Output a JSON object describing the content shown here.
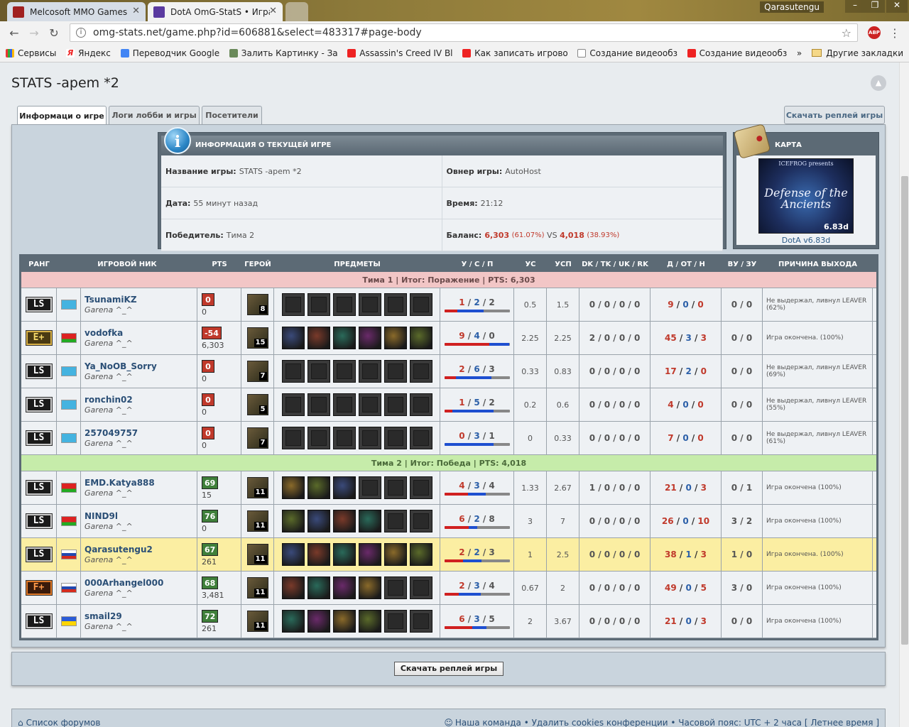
{
  "browser": {
    "tabs": [
      {
        "title": "Melcosoft MMO Games"
      },
      {
        "title": "DotA OmG-StatS • Игра"
      }
    ],
    "user": "Qarasutengu",
    "url": "omg-stats.net/game.php?id=606881&select=483317#page-body",
    "bookmarks": [
      "Сервисы",
      "Яндекс",
      "Переводчик Google",
      "Залить Картинку - За",
      "Assassin's Creed IV Bl",
      "Как записать игрово",
      "Создание видеообз",
      "Создание видеообз"
    ],
    "more": "»",
    "other": "Другие закладки"
  },
  "page": {
    "title": "STATS -apem *2",
    "tabs": [
      "Информаци о игре",
      "Логи лобби и игры",
      "Посетители"
    ],
    "download_top": "Скачать реплей игры",
    "download_bottom": "Скачать реплей игры"
  },
  "info": {
    "header": "ИНФОРМАЦИЯ О ТЕКУЩЕЙ ИГРЕ",
    "name_label": "Название игры:",
    "name": "STATS -apem *2",
    "owner_label": "Овнер игры:",
    "owner": "AutoHost",
    "date_label": "Дата:",
    "date": "55 минут назад",
    "time_label": "Время:",
    "time": "21:12",
    "winner_label": "Победитель:",
    "winner": "Тима 2",
    "balance_label": "Баланс:",
    "balance_a": "6,303",
    "balance_a_pct": "(61.07%)",
    "vs": "VS",
    "balance_b": "4,018",
    "balance_b_pct": "(38.93%)"
  },
  "map": {
    "header": "КАРТА",
    "img_t1": "ICEFROG presents",
    "img_t2": "Defense of the Ancients",
    "img_t3": "6.83d",
    "name": "DotA v6.83d"
  },
  "table": {
    "headers": [
      "РАНГ",
      "ИГРОВОЙ НИК",
      "PTS",
      "ГЕРОЙ",
      "ПРЕДМЕТЫ",
      "У / С / П",
      "УС",
      "УСП",
      "DK / TK / UK / RK",
      "Д / ОТ / Н",
      "ВУ / ЗУ",
      "ПРИЧИНА ВЫХОДА"
    ],
    "team1": "Тима 1 | Итог: Поражение | PTS: 6,303",
    "team2": "Тима 2 | Итог: Победа | PTS: 4,018",
    "players": [
      {
        "rank": "LS",
        "flag": "kz",
        "nick": "TsunamiKZ",
        "sub": "Garena ^_^",
        "pts": "0",
        "pts_total": "0",
        "hero_lvl": "8",
        "items": [
          0,
          0,
          0,
          0,
          0,
          0
        ],
        "k": "1",
        "d": "2",
        "a": "2",
        "us": "0.5",
        "usp": "1.5",
        "dk": "0 / 0 / 0 / 0",
        "dn": "9",
        "ot": "0",
        "n": "0",
        "vu": "0 / 0",
        "reason": "Не выдержал, ливнул LEAVER (62%)",
        "team": 1
      },
      {
        "rank": "E+",
        "flag": "by",
        "nick": "vodofka",
        "sub": "Garena ^_^",
        "pts": "-54",
        "pts_total": "6,303",
        "hero_lvl": "15",
        "items": [
          1,
          1,
          1,
          1,
          1,
          1
        ],
        "k": "9",
        "d": "4",
        "a": "0",
        "us": "2.25",
        "usp": "2.25",
        "dk": "2 / 0 / 0 / 0",
        "dn": "45",
        "ot": "3",
        "n": "3",
        "vu": "0 / 0",
        "reason": "Игра окончена. (100%)",
        "team": 1
      },
      {
        "rank": "LS",
        "flag": "kz",
        "nick": "Ya_NoOB_Sorry",
        "sub": "Garena ^_^",
        "pts": "0",
        "pts_total": "0",
        "hero_lvl": "7",
        "items": [
          0,
          0,
          0,
          0,
          0,
          0
        ],
        "k": "2",
        "d": "6",
        "a": "3",
        "us": "0.33",
        "usp": "0.83",
        "dk": "0 / 0 / 0 / 0",
        "dn": "17",
        "ot": "2",
        "n": "0",
        "vu": "0 / 0",
        "reason": "Не выдержал, ливнул LEAVER (69%)",
        "team": 1
      },
      {
        "rank": "LS",
        "flag": "kz",
        "nick": "ronchin02",
        "sub": "Garena ^_^",
        "pts": "0",
        "pts_total": "0",
        "hero_lvl": "5",
        "items": [
          0,
          0,
          0,
          0,
          0,
          0
        ],
        "k": "1",
        "d": "5",
        "a": "2",
        "us": "0.2",
        "usp": "0.6",
        "dk": "0 / 0 / 0 / 0",
        "dn": "4",
        "ot": "0",
        "n": "0",
        "vu": "0 / 0",
        "reason": "Не выдержал, ливнул LEAVER (55%)",
        "team": 1
      },
      {
        "rank": "LS",
        "flag": "kz",
        "nick": "257049757",
        "sub": "Garena ^_^",
        "pts": "0",
        "pts_total": "0",
        "hero_lvl": "7",
        "items": [
          0,
          0,
          0,
          0,
          0,
          0
        ],
        "k": "0",
        "d": "3",
        "a": "1",
        "us": "0",
        "usp": "0.33",
        "dk": "0 / 0 / 0 / 0",
        "dn": "7",
        "ot": "0",
        "n": "0",
        "vu": "0 / 0",
        "reason": "Не выдержал, ливнул LEAVER (61%)",
        "team": 1
      },
      {
        "rank": "LS",
        "flag": "by",
        "nick": "EMD.Katya888",
        "sub": "Garena ^_^",
        "pts": "69",
        "pts_total": "15",
        "hero_lvl": "11",
        "items": [
          1,
          1,
          1,
          0,
          0,
          0
        ],
        "k": "4",
        "d": "3",
        "a": "4",
        "us": "1.33",
        "usp": "2.67",
        "dk": "1 / 0 / 0 / 0",
        "dn": "21",
        "ot": "0",
        "n": "3",
        "vu": "0 / 1",
        "reason": "Игра окончена (100%)",
        "team": 2
      },
      {
        "rank": "LS",
        "flag": "by",
        "nick": "NIND9l",
        "sub": "Garena ^_^",
        "pts": "76",
        "pts_total": "0",
        "hero_lvl": "11",
        "items": [
          1,
          1,
          1,
          1,
          0,
          0
        ],
        "k": "6",
        "d": "2",
        "a": "8",
        "us": "3",
        "usp": "7",
        "dk": "0 / 0 / 0 / 0",
        "dn": "26",
        "ot": "0",
        "n": "10",
        "vu": "3 / 2",
        "reason": "Игра окончена (100%)",
        "team": 2
      },
      {
        "rank": "LS",
        "flag": "ru",
        "nick": "Qarasutengu2",
        "sub": "Garena ^_^",
        "pts": "67",
        "pts_total": "261",
        "hero_lvl": "11",
        "items": [
          1,
          1,
          1,
          1,
          1,
          1
        ],
        "k": "2",
        "d": "2",
        "a": "3",
        "us": "1",
        "usp": "2.5",
        "dk": "0 / 0 / 0 / 0",
        "dn": "38",
        "ot": "1",
        "n": "3",
        "vu": "1 / 0",
        "reason": "Игра окончена. (100%)",
        "team": 2,
        "hl": true
      },
      {
        "rank": "F+",
        "flag": "ru",
        "nick": "000Arhangel000",
        "sub": "Garena ^_^",
        "pts": "68",
        "pts_total": "3,481",
        "hero_lvl": "11",
        "items": [
          1,
          1,
          1,
          1,
          0,
          0
        ],
        "k": "2",
        "d": "3",
        "a": "4",
        "us": "0.67",
        "usp": "2",
        "dk": "0 / 0 / 0 / 0",
        "dn": "49",
        "ot": "0",
        "n": "5",
        "vu": "3 / 0",
        "reason": "Игра окончена (100%)",
        "team": 2
      },
      {
        "rank": "LS",
        "flag": "ua",
        "nick": "smail29",
        "sub": "Garena ^_^",
        "pts": "72",
        "pts_total": "261",
        "hero_lvl": "11",
        "items": [
          1,
          1,
          1,
          1,
          0,
          0
        ],
        "k": "6",
        "d": "3",
        "a": "5",
        "us": "2",
        "usp": "3.67",
        "dk": "0 / 0 / 0 / 0",
        "dn": "21",
        "ot": "0",
        "n": "3",
        "vu": "0 / 0",
        "reason": "Игра окончена (100%)",
        "team": 2
      }
    ]
  },
  "footer": {
    "left": "Список форумов",
    "right": "Наша команда • Удалить cookies конференции • Часовой пояс: UTC + 2 часа [ Летнее время ]"
  },
  "colors": {
    "panel": "#c9d4dd",
    "header": "#5c6a75",
    "link": "#2b4f76",
    "kill": "#c0392b",
    "death": "#2b5fa8"
  }
}
